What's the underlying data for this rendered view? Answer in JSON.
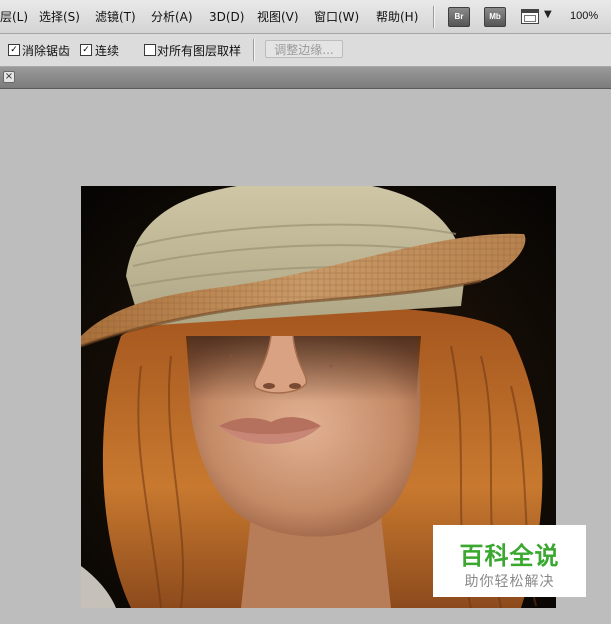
{
  "menubar": {
    "items": [
      "层(L)",
      "选择(S)",
      "滤镜(T)",
      "分析(A)",
      "3D(D)",
      "视图(V)",
      "窗口(W)",
      "帮助(H)"
    ],
    "bridge_label": "Br",
    "minibridge_label": "Mb",
    "zoom": "100%"
  },
  "options": {
    "anti_alias": {
      "label": "消除锯齿",
      "checked": true
    },
    "contiguous": {
      "label": "连续",
      "checked": true
    },
    "sample_all_layers": {
      "label": "对所有图层取样",
      "checked": false
    },
    "refine_edge_label": "调整边缘..."
  },
  "document": {
    "close_glyph": "×"
  },
  "watermark": {
    "title": "百科全说",
    "subtitle": "助你轻松解决"
  }
}
